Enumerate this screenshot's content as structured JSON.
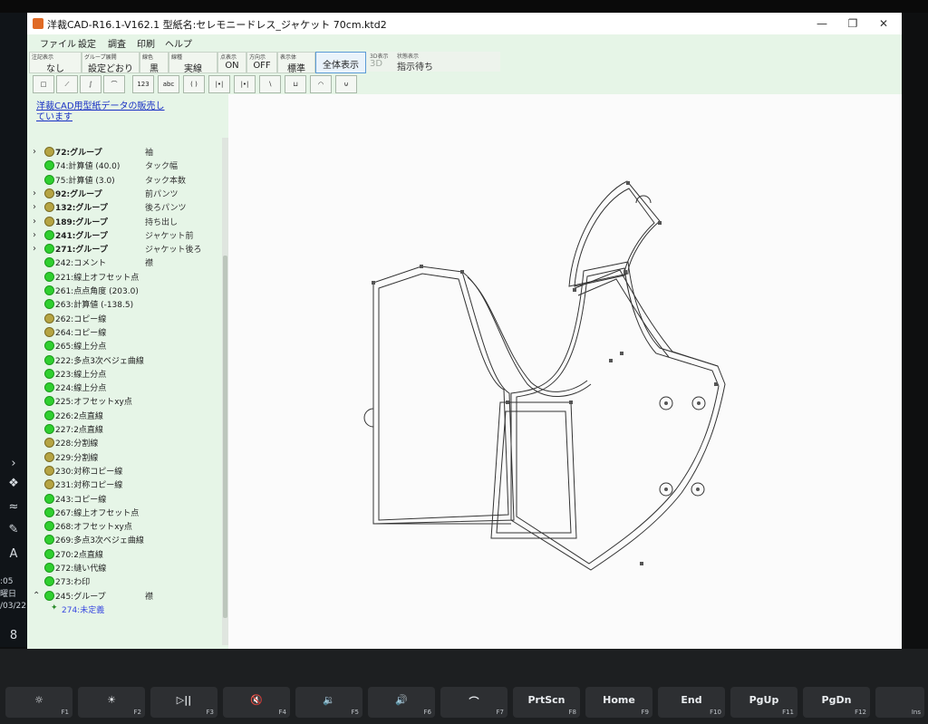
{
  "window": {
    "title": "洋裁CAD-R16.1-V162.1 型紙名:セレモニードレス_ジャケット 70cm.ktd2",
    "min_icon": "minimize-icon",
    "restore_icon": "restore-icon",
    "close_icon": "close-icon",
    "min_glyph": "—",
    "restore_glyph": "❐",
    "close_glyph": "✕"
  },
  "menu": [
    "ファイル",
    "設定",
    "調査",
    "印刷",
    "ヘルプ"
  ],
  "options": [
    {
      "caption": "注記表示",
      "value": "なし"
    },
    {
      "caption": "グループ展開",
      "value": "設定どおり"
    },
    {
      "caption": "線色",
      "value": "黒"
    },
    {
      "caption": "線種",
      "value": "実線"
    },
    {
      "caption": "点表示",
      "value": "ON"
    },
    {
      "caption": "方向示",
      "value": "OFF"
    },
    {
      "caption": "表示体",
      "value": "標準"
    }
  ],
  "fullview_button": "全体表示",
  "status": {
    "caption_3d": "3D表示",
    "value_3d": "3D",
    "caption_state": "状態表示",
    "value_state": "指示待ち"
  },
  "tools": [
    {
      "name": "rectangle-tool",
      "glyph": "□"
    },
    {
      "name": "line-tool",
      "glyph": "⟋"
    },
    {
      "name": "curve-tool",
      "glyph": "∫"
    },
    {
      "name": "arc-tool",
      "glyph": "⌒"
    },
    {
      "name": "number-tool",
      "glyph": "123"
    },
    {
      "name": "text-tool",
      "glyph": "abc"
    },
    {
      "name": "bracket-tool",
      "glyph": "( )"
    },
    {
      "name": "measure-tool",
      "glyph": "|•|"
    },
    {
      "name": "measure-end-tool",
      "glyph": "|•|"
    },
    {
      "name": "corner-tool",
      "glyph": "∖"
    },
    {
      "name": "dart-tool",
      "glyph": "⊔"
    },
    {
      "name": "half-circle-tool",
      "glyph": "◠"
    },
    {
      "name": "pocket-tool",
      "glyph": "⊍"
    }
  ],
  "promo_link": "洋裁CAD用型紙データの販売しています",
  "tree": [
    {
      "label": "72:グループ",
      "note": "袖",
      "caret": "›",
      "bullet": "olive",
      "bold": true
    },
    {
      "label": "74:計算値 (40.0)",
      "note": "タック幅",
      "bullet": "green"
    },
    {
      "label": "75:計算値 (3.0)",
      "note": "タック本数",
      "bullet": "green"
    },
    {
      "label": "92:グループ",
      "note": "前パンツ",
      "caret": "›",
      "bullet": "olive",
      "bold": true
    },
    {
      "label": "132:グループ",
      "note": "後ろパンツ",
      "caret": "›",
      "bullet": "olive",
      "bold": true
    },
    {
      "label": "189:グループ",
      "note": "持ち出し",
      "caret": "›",
      "bullet": "olive",
      "bold": true
    },
    {
      "label": "241:グループ",
      "note": "ジャケット前",
      "caret": "›",
      "bullet": "green",
      "bold": true
    },
    {
      "label": "271:グループ",
      "note": "ジャケット後ろ",
      "caret": "›",
      "bullet": "green",
      "bold": true
    },
    {
      "label": "242:コメント",
      "note": "襟",
      "bullet": "green"
    },
    {
      "label": "221:線上オフセット点",
      "note": "",
      "bullet": "green"
    },
    {
      "label": "261:点点角度 (203.0)",
      "note": "",
      "bullet": "green"
    },
    {
      "label": "263:計算値 (-138.5)",
      "note": "",
      "bullet": "green"
    },
    {
      "label": "262:コピー線",
      "note": "",
      "bullet": "olive"
    },
    {
      "label": "264:コピー線",
      "note": "",
      "bullet": "olive"
    },
    {
      "label": "265:線上分点",
      "note": "",
      "bullet": "green"
    },
    {
      "label": "222:多点3次ベジェ曲線",
      "note": "",
      "bullet": "green"
    },
    {
      "label": "223:線上分点",
      "note": "",
      "bullet": "green"
    },
    {
      "label": "224:線上分点",
      "note": "",
      "bullet": "green"
    },
    {
      "label": "225:オフセットxy点",
      "note": "",
      "bullet": "green"
    },
    {
      "label": "226:2点直線",
      "note": "",
      "bullet": "green"
    },
    {
      "label": "227:2点直線",
      "note": "",
      "bullet": "green"
    },
    {
      "label": "228:分割線",
      "note": "",
      "bullet": "olive"
    },
    {
      "label": "229:分割線",
      "note": "",
      "bullet": "olive"
    },
    {
      "label": "230:対称コピー線",
      "note": "",
      "bullet": "olive"
    },
    {
      "label": "231:対称コピー線",
      "note": "",
      "bullet": "olive"
    },
    {
      "label": "243:コピー線",
      "note": "",
      "bullet": "green"
    },
    {
      "label": "267:線上オフセット点",
      "note": "",
      "bullet": "green"
    },
    {
      "label": "268:オフセットxy点",
      "note": "",
      "bullet": "green"
    },
    {
      "label": "269:多点3次ベジェ曲線",
      "note": "",
      "bullet": "green"
    },
    {
      "label": "270:2点直線",
      "note": "",
      "bullet": "green"
    },
    {
      "label": "272:縫い代線",
      "note": "",
      "bullet": "green"
    },
    {
      "label": "273:わ印",
      "note": "",
      "bullet": "green"
    },
    {
      "label": "245:グループ",
      "note": "襟",
      "caret": "⌃",
      "bullet": "green"
    },
    {
      "label": "274:未定義",
      "note": "",
      "bullet": "sparkle",
      "blue": true
    }
  ],
  "taskbar": {
    "clock_time": ":05",
    "clock_day": "曜日",
    "clock_date": "/03/22",
    "badge": "8"
  },
  "keys": [
    {
      "main": "☼",
      "fn": "F1"
    },
    {
      "main": "☀",
      "fn": "F2"
    },
    {
      "main": "▷||",
      "fn": "F3"
    },
    {
      "main": "🔇",
      "fn": "F4"
    },
    {
      "main": "🔉",
      "fn": "F5"
    },
    {
      "main": "🔊",
      "fn": "F6"
    },
    {
      "main": "⌒",
      "fn": "F7"
    },
    {
      "main": "PrtScn",
      "fn": "F8"
    },
    {
      "main": "Home",
      "fn": "F9"
    },
    {
      "main": "End",
      "fn": "F10"
    },
    {
      "main": "PgUp",
      "fn": "F11"
    },
    {
      "main": "PgDn",
      "fn": "F12"
    },
    {
      "main": "",
      "fn": "Ins"
    }
  ]
}
